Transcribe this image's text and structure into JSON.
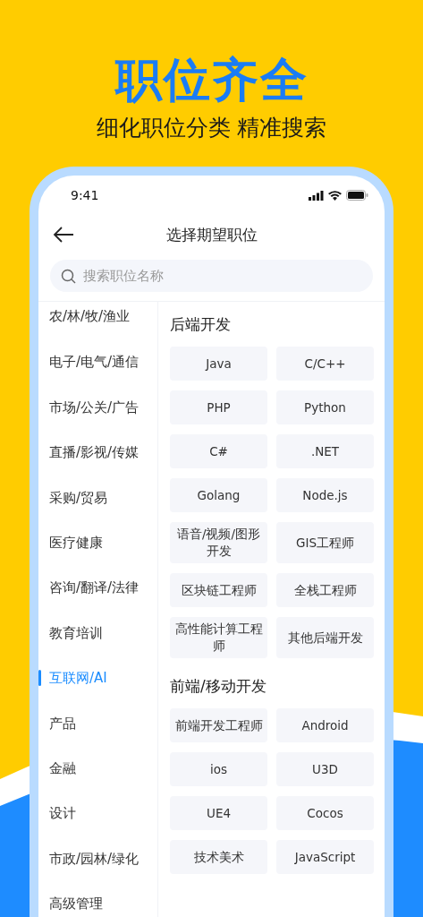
{
  "headline": "职位齐全",
  "subheadline": "细化职位分类 精准搜索",
  "status_bar": {
    "time": "9:41"
  },
  "nav": {
    "title": "选择期望职位"
  },
  "search": {
    "placeholder": "搜索职位名称"
  },
  "categories": [
    {
      "label": "农/林/牧/渔业",
      "selected": false
    },
    {
      "label": "电子/电气/通信",
      "selected": false
    },
    {
      "label": "市场/公关/广告",
      "selected": false
    },
    {
      "label": "直播/影视/传媒",
      "selected": false
    },
    {
      "label": "采购/贸易",
      "selected": false
    },
    {
      "label": "医疗健康",
      "selected": false
    },
    {
      "label": "咨询/翻译/法律",
      "selected": false
    },
    {
      "label": "教育培训",
      "selected": false
    },
    {
      "label": "互联网/AI",
      "selected": true
    },
    {
      "label": "产品",
      "selected": false
    },
    {
      "label": "金融",
      "selected": false
    },
    {
      "label": "设计",
      "selected": false
    },
    {
      "label": "市政/园林/绿化",
      "selected": false
    },
    {
      "label": "高级管理",
      "selected": false
    }
  ],
  "sections": [
    {
      "title": "后端开发",
      "positions": [
        "Java",
        "C/C++",
        "PHP",
        "Python",
        "C#",
        ".NET",
        "Golang",
        "Node.js",
        "语音/视频/图形开发",
        "GIS工程师",
        "区块链工程师",
        "全栈工程师",
        "高性能计算工程师",
        "其他后端开发"
      ]
    },
    {
      "title": "前端/移动开发",
      "positions": [
        "前端开发工程师",
        "Android",
        "ios",
        "U3D",
        "UE4",
        "Cocos",
        "技术美术",
        "JavaScript"
      ]
    }
  ]
}
